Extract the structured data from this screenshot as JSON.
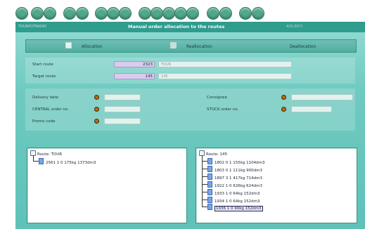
{
  "window": {
    "title_left": "TOURPOTRADIO",
    "title": "Manual order allocation to the routes",
    "title_right": "420.0071"
  },
  "modes": [
    {
      "label": "Allocation",
      "checked": false
    },
    {
      "label": "Reallocation",
      "checked": true
    },
    {
      "label": "Deallocation",
      "checked": false
    }
  ],
  "routes": {
    "start_label": "Start route",
    "start_value": "2323",
    "start_desc": "TOUR",
    "target_label": "Target route",
    "target_value": "145",
    "target_desc": "145"
  },
  "filters": {
    "delivery_date_label": "Delivery date",
    "central_order_label": "CENTRAL order no.",
    "promo_code_label": "Promo code",
    "consignee_label": "Consignee",
    "stock_order_label": "STOCK order no."
  },
  "left_tree": {
    "root": "Route: TOUR",
    "items": [
      "2561  1  0  175kg  1373dm3"
    ]
  },
  "right_tree": {
    "root": "Route: 145",
    "items": [
      "1802  0  1  155kg  1104dm3",
      "1803  0  1  111kg  900dm3",
      "1897  3  1  417kg  714dm3",
      "1922  1  0  626kg  624dm3",
      "1933  1  0  64kg  152dm3",
      "1934  1  0  64kg  152dm3",
      "1936  1  0  90kg  152dm3"
    ]
  },
  "colors": {
    "accent": "#2f9c8e",
    "panel": "#6fcac0",
    "number_field": "#d7ccee",
    "indicator": "#b46a14"
  }
}
